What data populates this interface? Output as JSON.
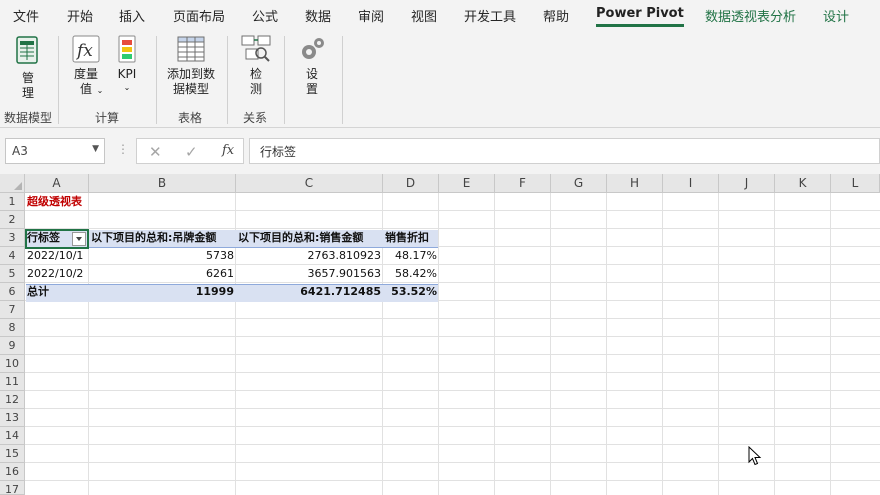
{
  "ribbon_tabs": [
    "文件",
    "开始",
    "插入",
    "页面布局",
    "公式",
    "数据",
    "审阅",
    "视图",
    "开发工具",
    "帮助",
    "Power Pivot",
    "数据透视表分析",
    "设计"
  ],
  "active_tab": "Power Pivot",
  "ribbon": {
    "manage": "管理",
    "measure": "度量值",
    "kpi": "KPI",
    "add_to_model": "添加到数据模型",
    "detect": "检测",
    "settings": "设置",
    "group_data_model": "数据模型",
    "group_calc": "计算",
    "group_table": "表格",
    "group_relations": "关系"
  },
  "formula_bar": {
    "name_box": "A3",
    "cancel": "✕",
    "confirm": "✓",
    "fx": "fx",
    "content": "行标签"
  },
  "columns": [
    "A",
    "B",
    "C",
    "D",
    "E",
    "F",
    "G",
    "H",
    "I",
    "J",
    "K",
    "L"
  ],
  "rows": [
    "1",
    "2",
    "3",
    "4",
    "5",
    "6",
    "7",
    "8",
    "9",
    "10",
    "11",
    "12",
    "13",
    "14",
    "15",
    "16",
    "17"
  ],
  "sheet": {
    "title": "超级透视表",
    "header": [
      "行标签",
      "以下项目的总和:吊牌金额",
      "以下项目的总和:销售金额",
      "销售折扣"
    ],
    "data_rows": [
      [
        "2022/10/1",
        "5738",
        "2763.810923",
        "48.17%"
      ],
      [
        "2022/10/2",
        "6261",
        "3657.901563",
        "58.42%"
      ]
    ],
    "total": [
      "总计",
      "11999",
      "6421.712485",
      "53.52%"
    ]
  },
  "colors": {
    "accent": "#217346",
    "pivot_band": "#d9e1f2",
    "title_red": "#c00000"
  }
}
